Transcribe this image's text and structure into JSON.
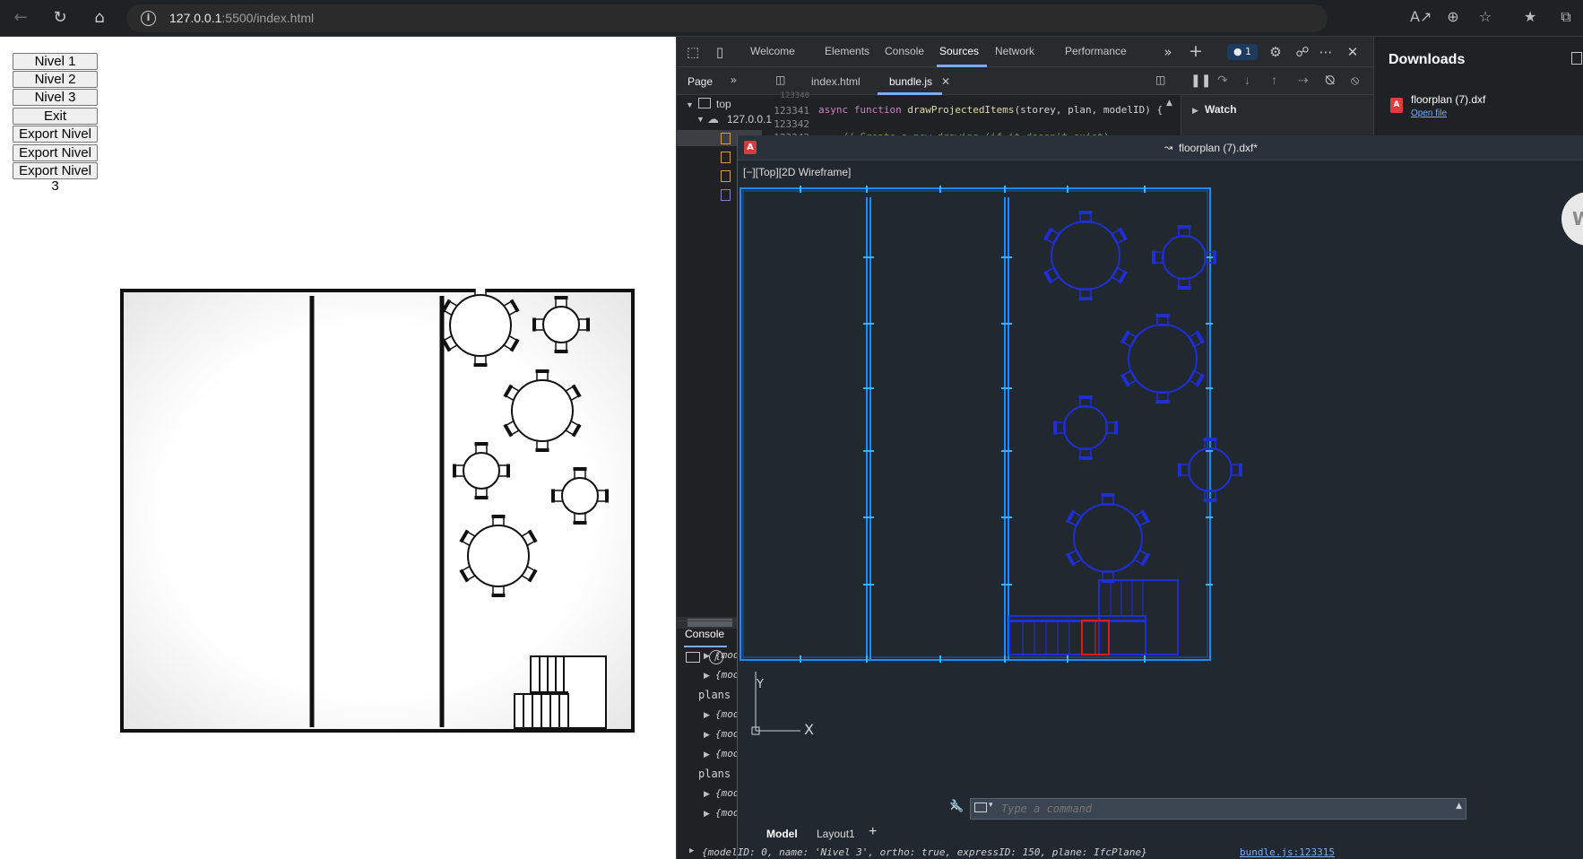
{
  "browser": {
    "url_host": "127.0.0.1",
    "url_path": ":5500/index.html"
  },
  "page": {
    "buttons": [
      "Nivel 1",
      "Nivel 2",
      "Nivel 3",
      "Exit floorplans",
      "Export Nivel 1",
      "Export Nivel 2",
      "Export Nivel 3"
    ]
  },
  "devtools": {
    "tabs": [
      "Welcome",
      "Elements",
      "Console",
      "Sources",
      "Network",
      "Performance"
    ],
    "active_tab": "Sources",
    "issues_count": "1",
    "page_label": "Page",
    "file_tabs": [
      "index.html",
      "bundle.js"
    ],
    "tree": {
      "top": "top",
      "host": "127.0.0.1"
    },
    "code": [
      {
        "ln": "123341",
        "text_kw": "async function ",
        "text_fn": "drawProjectedItems",
        "text_rest": "(storey, plan, modelID) {"
      },
      {
        "ln": "123342",
        "text_rest": ""
      },
      {
        "ln": "123343",
        "text_cm": "    // Create a new drawing (if it doesn't exist)"
      }
    ],
    "watch_label": "Watch",
    "console_label": "Console",
    "console_lines": [
      {
        "kind": "obj",
        "text": "{mod"
      },
      {
        "kind": "obj",
        "text": "{mod"
      },
      {
        "kind": "plain",
        "text": "plans c"
      },
      {
        "kind": "obj",
        "text": "{mod"
      },
      {
        "kind": "obj",
        "text": "{mod"
      },
      {
        "kind": "obj",
        "text": "{mod"
      },
      {
        "kind": "plain",
        "text": "plans c"
      },
      {
        "kind": "obj",
        "text": "{mod"
      },
      {
        "kind": "obj",
        "text": "{mod"
      }
    ],
    "last_log": "{modelID: 0, name: 'Nivel 3', ortho: true, expressID: 150, plane: IfcPlane}",
    "last_log_source": "bundle.js:123315"
  },
  "downloads": {
    "title": "Downloads",
    "file_name": "floorplan (7).dxf",
    "open_label": "Open file"
  },
  "cad": {
    "title": "floorplan (7).dxf*",
    "view_label": "[−][Top][2D Wireframe]",
    "command_placeholder": "Type a command",
    "layout_tabs": [
      "Model",
      "Layout1"
    ],
    "axis_y": "Y",
    "axis_x": "X",
    "side_letter": "W"
  },
  "colors": {
    "cad_background": "#212830",
    "cad_wall": "#1a8cff",
    "cad_furniture": "#1f2fd6",
    "cad_highlight": "#d62020",
    "devtools_accent": "#7cacf8"
  }
}
